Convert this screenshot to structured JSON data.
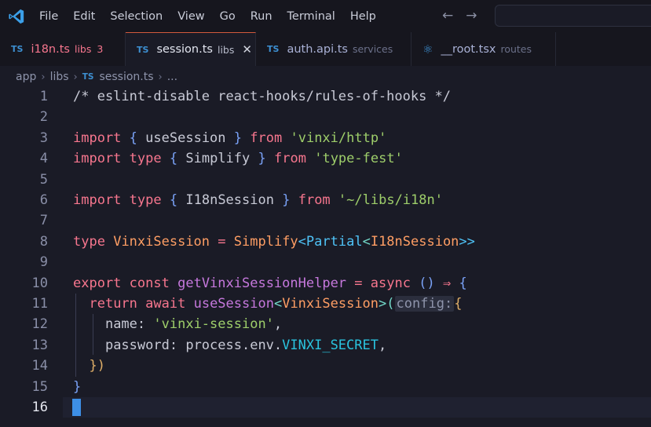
{
  "menu": {
    "items": [
      "File",
      "Edit",
      "Selection",
      "View",
      "Go",
      "Run",
      "Terminal",
      "Help"
    ]
  },
  "tabs": [
    {
      "name": "i18n.ts",
      "path": "libs",
      "count": "3",
      "badge": "TS"
    },
    {
      "name": "session.ts",
      "path": "libs",
      "badge": "TS",
      "close": "✕"
    },
    {
      "name": "auth.api.ts",
      "path": "services",
      "badge": "TS"
    },
    {
      "name": "__root.tsx",
      "path": "routes",
      "badge": "⚛"
    }
  ],
  "breadcrumb": {
    "parts": [
      "app",
      "libs"
    ],
    "badge": "TS",
    "file": "session.ts",
    "tail": "..."
  },
  "editor": {
    "line_numbers": [
      "1",
      "2",
      "3",
      "4",
      "5",
      "6",
      "7",
      "8",
      "9",
      "10",
      "11",
      "12",
      "13",
      "14",
      "15",
      "16"
    ],
    "current_line": "16",
    "tokens": {
      "l1": "/* eslint-disable react-hooks/rules-of-hooks */",
      "import": "import",
      "type": "type",
      "from": "from",
      "ob": "{",
      "cb": "}",
      "useSession": "useSession",
      "vinxi_http": "'vinxi/http'",
      "Simplify": "Simplify",
      "type_fest": "'type-fest'",
      "I18nSession": "I18nSession",
      "libs_i18n": "'~/libs/i18n'",
      "VinxiSession": "VinxiSession",
      "eq": "=",
      "lt": "<",
      "gt": ">",
      "gtgt": ">>",
      "Partial": "Partial",
      "export": "export",
      "const": "const",
      "getVinxiSessionHelper": "getVinxiSessionHelper",
      "async": "async",
      "parens": "()",
      "arrow": "⇒",
      "return": "return",
      "await": "await",
      "op": "(",
      "cp": ")",
      "config_hint": "config:",
      "name_key": "name:",
      "name_val": "'vinxi-session'",
      "comma": ",",
      "password_key": "password:",
      "process_env": "process.env.",
      "VINXI_SECRET": "VINXI_SECRET",
      "close_obj": "})"
    }
  }
}
